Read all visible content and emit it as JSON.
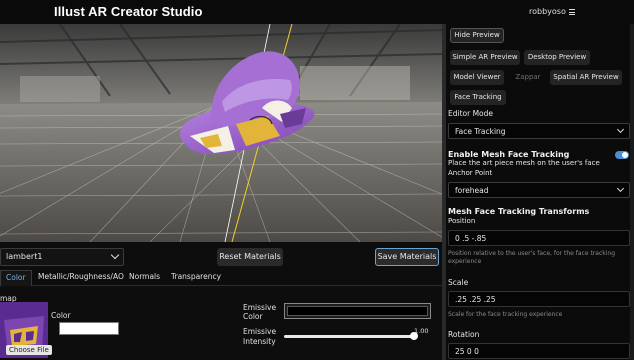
{
  "header": {
    "title": "Illust AR Creator Studio",
    "user": "robbyoso",
    "menu_icon": "hamburger-icon"
  },
  "material_bar": {
    "selected_material": "lambert1",
    "reset_label": "Reset Materials",
    "save_label": "Save Materials"
  },
  "tabs": [
    {
      "label": "Color",
      "active": true
    },
    {
      "label": "Metallic/Roughness/AO",
      "active": false
    },
    {
      "label": "Normals",
      "active": false
    },
    {
      "label": "Transparency",
      "active": false
    }
  ],
  "material_editor": {
    "map_label": "map",
    "choose_file_label": "Choose File",
    "color_label": "Color",
    "color_value": "#ffffff",
    "emissive_label": "Emissive Color",
    "emissive_value": "#000000",
    "intensity_label": "Emissive Intensity",
    "intensity_value": "1.00",
    "intensity_fraction": 1.0
  },
  "right_panel": {
    "hide_preview": "Hide Preview",
    "preview_buttons": [
      {
        "label": "Simple AR Preview"
      },
      {
        "label": "Desktop Preview"
      },
      {
        "label": "Model Viewer"
      },
      {
        "label": "Zappar"
      },
      {
        "label": "Spatial AR Preview"
      },
      {
        "label": "Face Tracking"
      }
    ],
    "editor_mode_label": "Editor Mode",
    "editor_mode_value": "Face Tracking",
    "mesh_tracking_title": "Enable Mesh Face Tracking",
    "mesh_tracking_desc": "Place the art piece mesh on the user's face",
    "mesh_tracking_enabled": true,
    "anchor_label": "Anchor Point",
    "anchor_value": "forehead",
    "transforms_title": "Mesh Face Tracking Transforms",
    "position_label": "Position",
    "position_value": "0 .5 -.85",
    "position_hint": "Position relative to the user's face, for the face tracking experience",
    "scale_label": "Scale",
    "scale_value": ".25 .25 .25",
    "scale_hint": "Scale for the face tracking experience",
    "rotation_label": "Rotation",
    "rotation_value": "25 0 0"
  },
  "colors": {
    "accent": "#4a8ed8",
    "hat_purple": "#9b5fc8",
    "hat_gold": "#e2b53a"
  }
}
